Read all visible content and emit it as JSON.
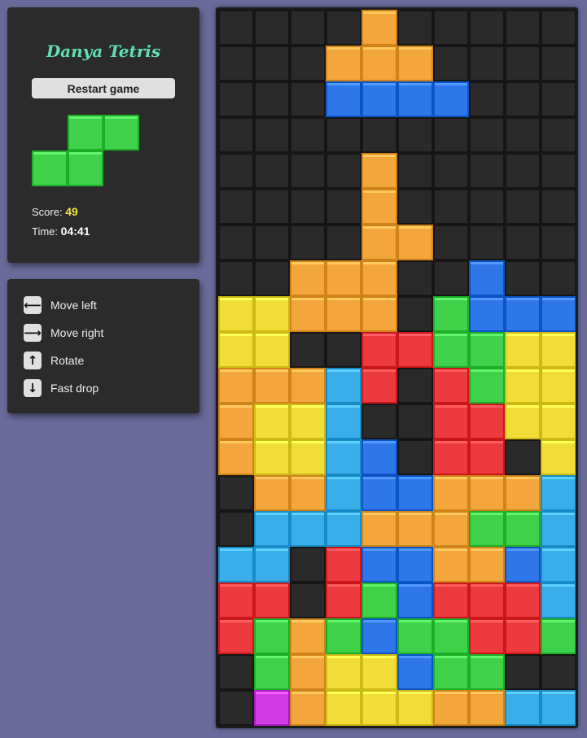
{
  "app": {
    "title": "Danya Tetris"
  },
  "actions": {
    "restart_label": "Restart game"
  },
  "stats": {
    "score_label": "Score:",
    "score_value": "49",
    "time_label": "Time:",
    "time_value": "04:41"
  },
  "controls": [
    {
      "icon": "arrow-left-icon",
      "glyph": "⟵",
      "label": "Move left"
    },
    {
      "icon": "arrow-right-icon",
      "glyph": "⟶",
      "label": "Move right"
    },
    {
      "icon": "arrow-up-icon",
      "glyph": "↑",
      "label": "Rotate"
    },
    {
      "icon": "arrow-down-icon",
      "glyph": "↓",
      "label": "Fast drop"
    }
  ],
  "colors": {
    "empty": "#2a2a2a",
    "orange": "#f3a63c",
    "blue": "#2f76e8",
    "green": "#3fd14a",
    "yellow": "#f1dd37",
    "red": "#ec3a3e",
    "cyan": "#3aaee8",
    "magenta": "#d13be3",
    "title": "#5fe0b0",
    "score": "#f0e24a"
  },
  "board": {
    "cols": 10,
    "rows": 20,
    "cells": [
      "....O.....",
      "...OOO....",
      "...BBBB...",
      "..........",
      "....O.....",
      "....O.....",
      "....OO....",
      "..OOO..B..",
      "YYOOO.GBBB",
      "YY..RRGGYY",
      "OOOCR.RGYY",
      "OYYC..RRYY",
      "OYYCB.RR.Y",
      ".OOCBBOOOC",
      ".CCCOOOGGC",
      "CC.RBBOOBC",
      "RR.RGBRRRC",
      "RGOGBGGRRG",
      ".GOYYBGG..",
      ".MOYYYOOCC"
    ]
  },
  "next_piece": {
    "color": "green",
    "cells": [
      ".GG",
      "GG."
    ]
  }
}
